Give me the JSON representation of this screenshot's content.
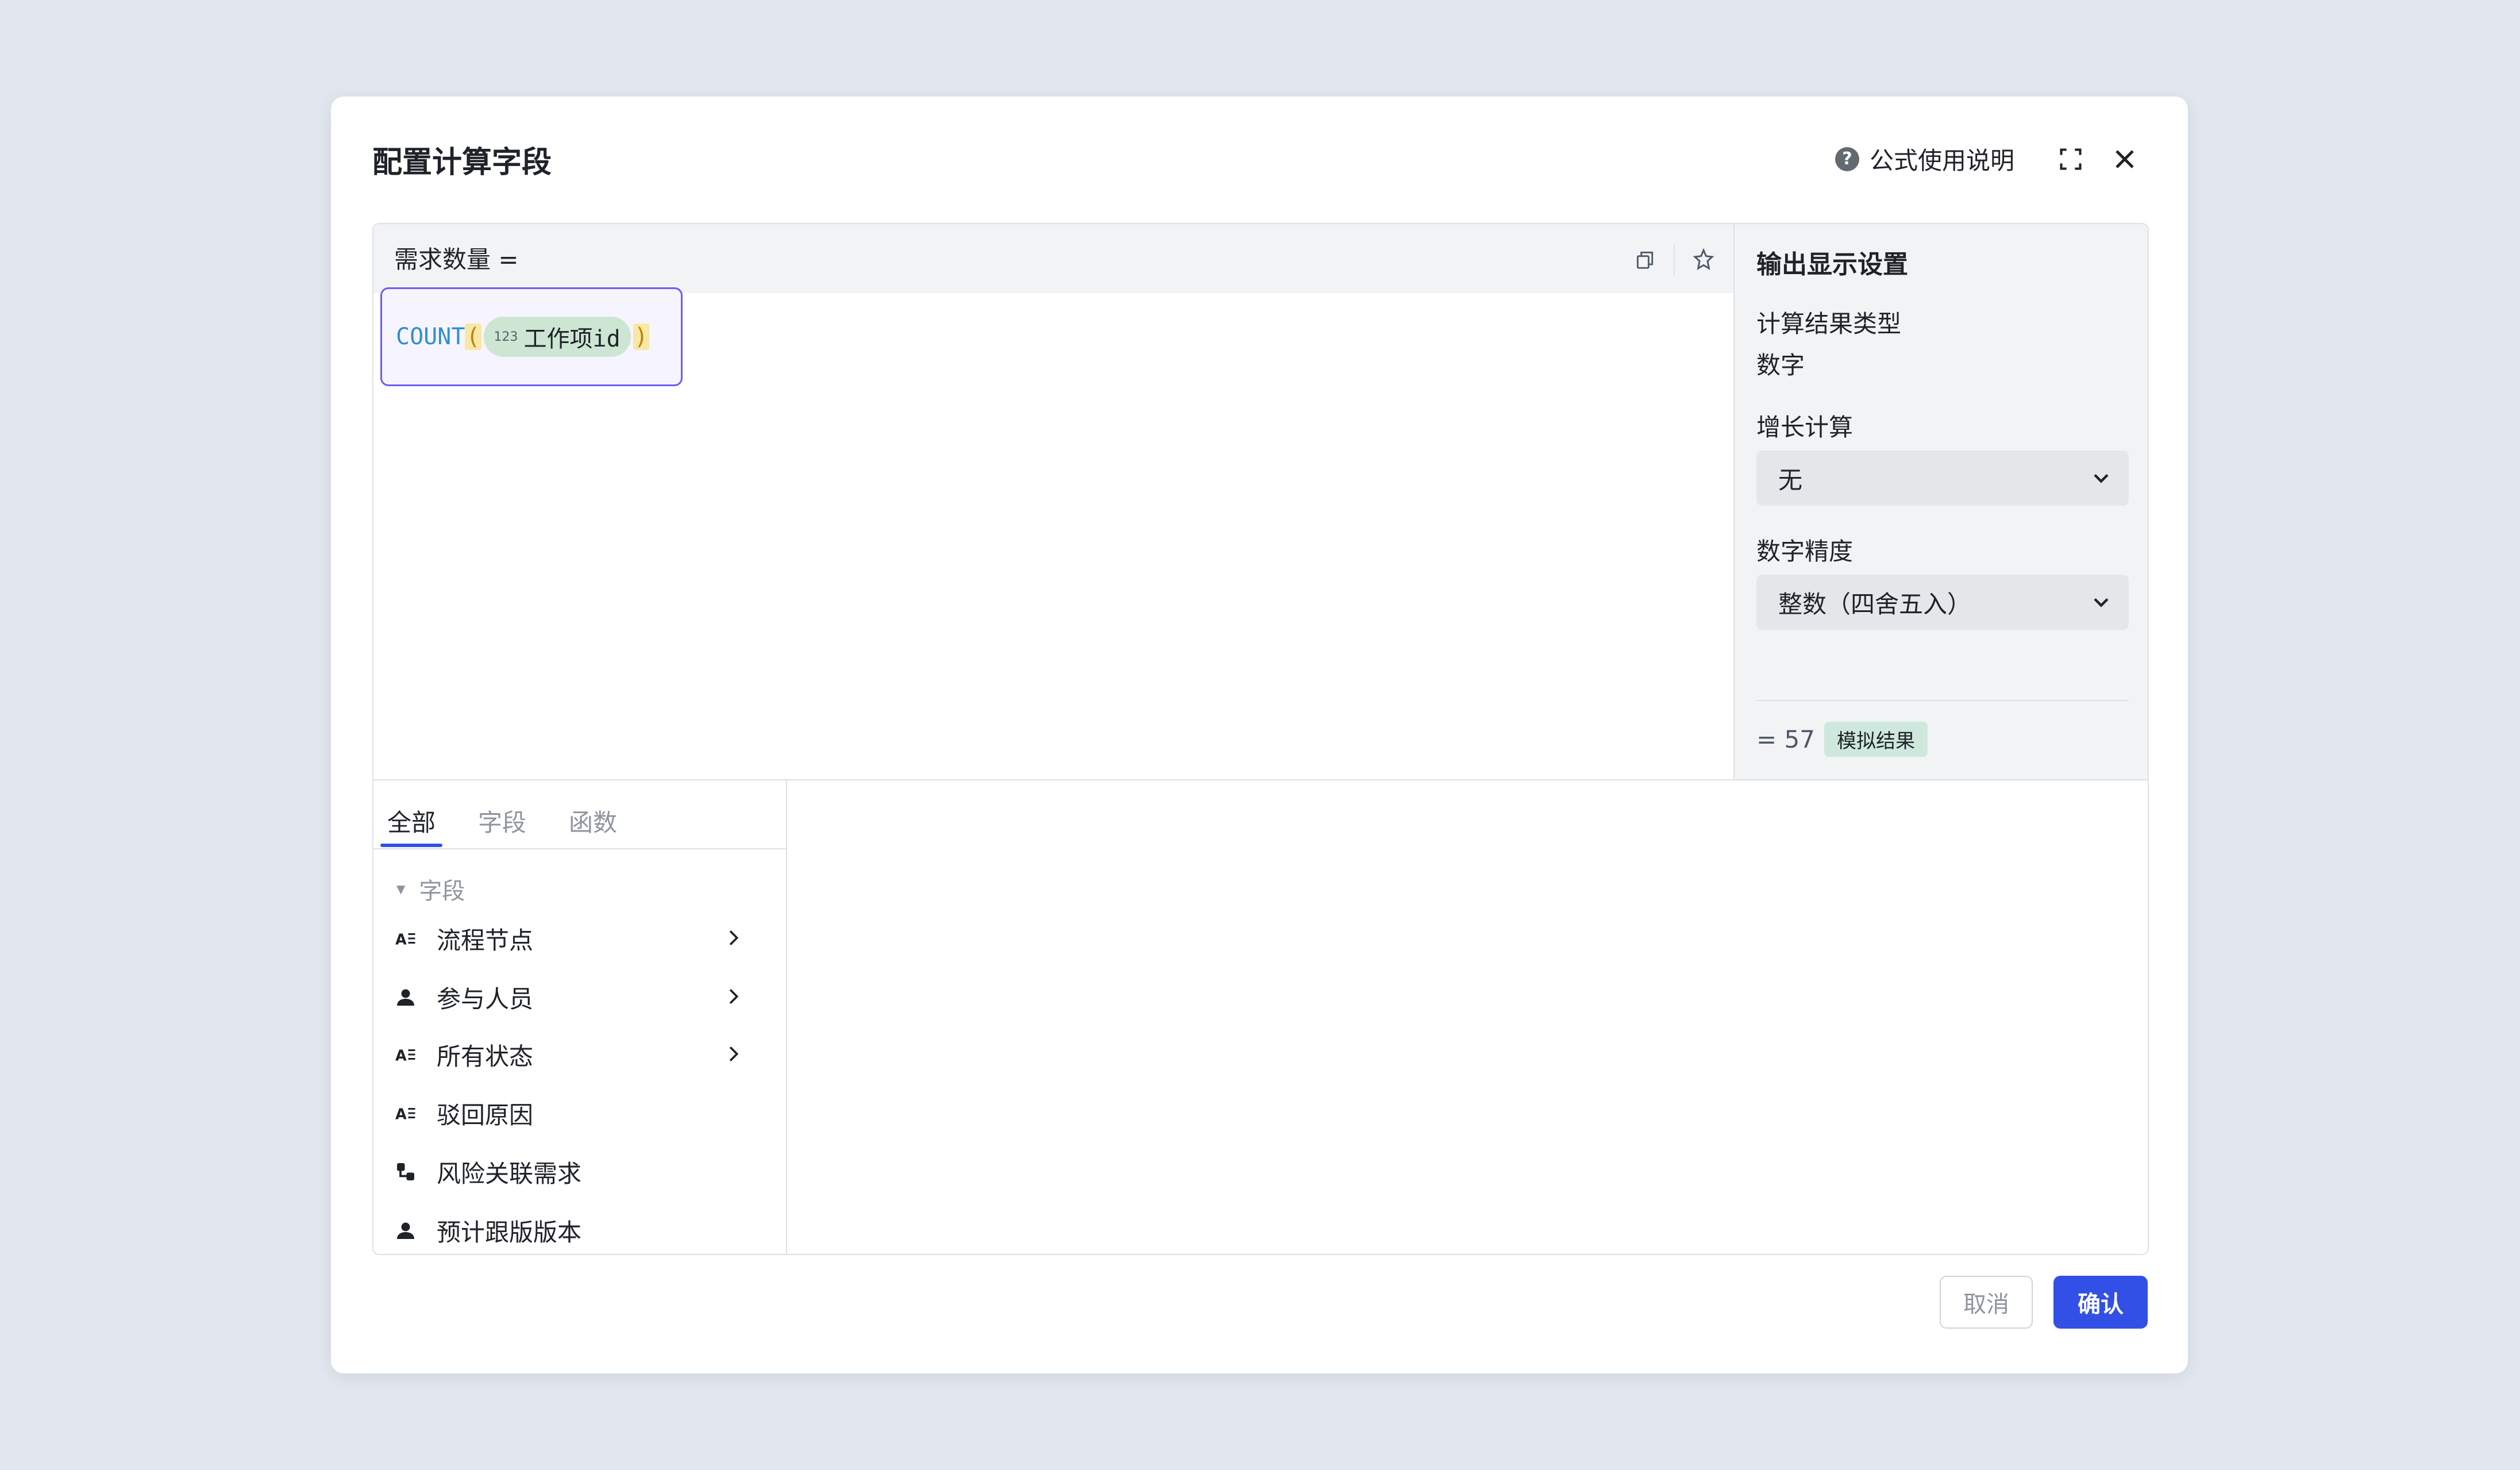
{
  "dialog": {
    "title": "配置计算字段",
    "help_label": "公式使用说明",
    "help_icon": "question-circle-icon",
    "expand_icon": "expand-icon",
    "close_icon": "close-icon"
  },
  "editor": {
    "formula_label": "需求数量 =",
    "function_name": "COUNT",
    "open_paren": "(",
    "close_paren": ")",
    "field_type_icon": "123",
    "field_name": "工作项id",
    "copy_icon": "copy-icon",
    "pin_icon": "pin-icon"
  },
  "settings": {
    "title": "输出显示设置",
    "result_type_label": "计算结果类型",
    "result_type_value": "数字",
    "growth_label": "增长计算",
    "growth_value": "无",
    "precision_label": "数字精度",
    "precision_value": "整数（四舍五入）",
    "result_prefix": "= 57",
    "result_tag": "模拟结果"
  },
  "tabs": [
    {
      "label": "全部",
      "active": true
    },
    {
      "label": "字段",
      "active": false
    },
    {
      "label": "函数",
      "active": false
    }
  ],
  "field_group": {
    "label": "字段",
    "items": [
      {
        "label": "流程节点",
        "icon": "text-field-icon",
        "has_children": true
      },
      {
        "label": "参与人员",
        "icon": "person-icon",
        "has_children": true
      },
      {
        "label": "所有状态",
        "icon": "text-field-icon",
        "has_children": true
      },
      {
        "label": "驳回原因",
        "icon": "text-field-icon",
        "has_children": false
      },
      {
        "label": "风险关联需求",
        "icon": "link-field-icon",
        "has_children": false
      },
      {
        "label": "预计跟版版本",
        "icon": "person-icon",
        "has_children": false
      }
    ]
  },
  "footer": {
    "cancel_label": "取消",
    "confirm_label": "确认"
  },
  "colors": {
    "primary": "#3250e6",
    "formula_border": "#6b5cf6",
    "field_chip": "#cde6d3",
    "paren_highlight": "#fbe7a4"
  }
}
